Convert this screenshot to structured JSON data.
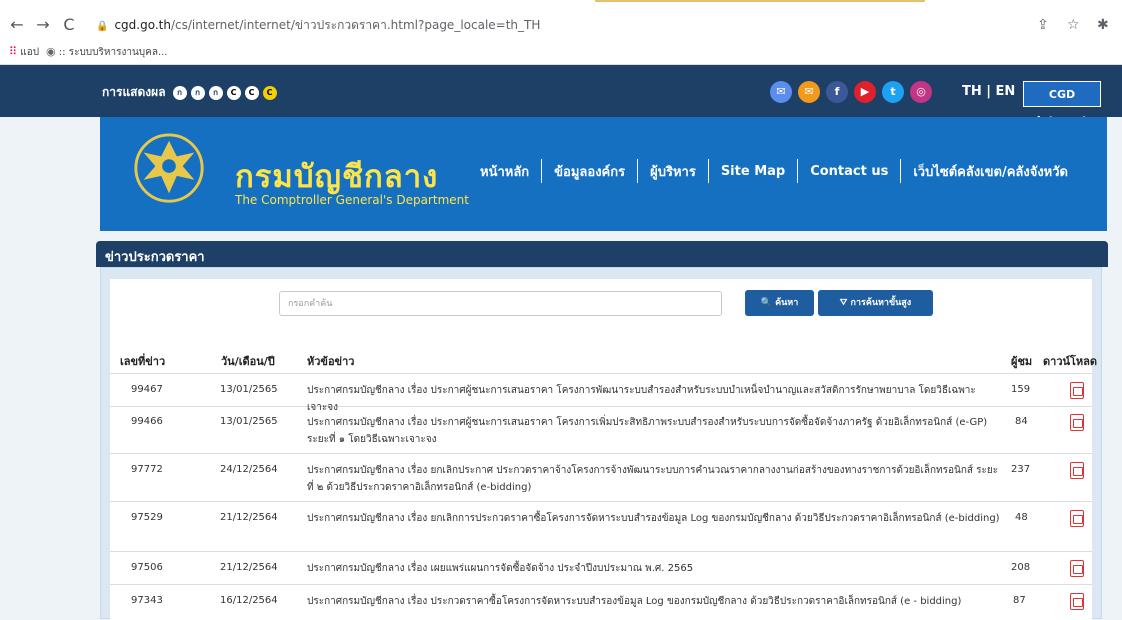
{
  "browser": {
    "url_host": "cgd.go.th",
    "url_path": "/cs/internet/internet/ข่าวประกวดราคา.html?page_locale=th_TH",
    "back_icon": "←",
    "forward_icon": "→",
    "reload_icon": "C",
    "share_icon": "⇪",
    "star_icon": "☆",
    "ext_icon": "✱",
    "bookmarks": [
      {
        "label": "แอป"
      },
      {
        "label": ":: ระบบบริหารงานบุคล..."
      }
    ]
  },
  "topbar": {
    "display_label": "การแสดงผล",
    "display_options": [
      {
        "glyph": "ก",
        "bg": "#ffffff",
        "fg": "#1e3f66"
      },
      {
        "glyph": "ก",
        "bg": "#ffffff",
        "fg": "#1e3f66"
      },
      {
        "glyph": "ก",
        "bg": "#ffffff",
        "fg": "#1e3f66"
      },
      {
        "glyph": "C",
        "bg": "#ffffff",
        "fg": "#000000"
      },
      {
        "glyph": "C",
        "bg": "#ffffff",
        "fg": "#000000"
      },
      {
        "glyph": "C",
        "bg": "#f0d000",
        "fg": "#000000"
      }
    ],
    "social": [
      {
        "name": "email-icon",
        "glyph": "✉",
        "color": "#5b8def"
      },
      {
        "name": "mail-icon",
        "glyph": "✉",
        "color": "#f39a1c"
      },
      {
        "name": "facebook-icon",
        "glyph": "f",
        "color": "#3b5998"
      },
      {
        "name": "youtube-icon",
        "glyph": "▶",
        "color": "#e0212b"
      },
      {
        "name": "twitter-icon",
        "glyph": "t",
        "color": "#1da1f2"
      },
      {
        "name": "instagram-icon",
        "glyph": "◎",
        "color": "#c13584"
      }
    ],
    "lang": "TH | EN",
    "intranet_label": "CGD Intranet"
  },
  "header": {
    "org_th": "กรมบัญชีกลาง",
    "org_en": "The Comptroller General's Department",
    "menu": [
      "หน้าหลัก",
      "ข้อมูลองค์กร",
      "ผู้บริหาร",
      "Site Map",
      "Contact us",
      "เว็บไซต์คลังเขต/คลังจังหวัด"
    ]
  },
  "section": {
    "title": "ข่าวประกวดราคา"
  },
  "search": {
    "placeholder": "กรอกคำค้น",
    "search_label": "🔍 ค้นหา",
    "advanced_label": "⛛ การค้นหาขั้นสูง"
  },
  "table": {
    "headers": {
      "id": "เลขที่ข่าว",
      "date": "วัน/เดือน/ปี",
      "title": "หัวข้อข่าว",
      "views": "ผู้ชม",
      "download": "ดาวน์โหลด"
    },
    "rows": [
      {
        "id": "99467",
        "date": "13/01/2565",
        "title": "ประกาศกรมบัญชีกลาง เรื่อง ประกาศผู้ชนะการเสนอราคา โครงการพัฒนาระบบสำรองสำหรับระบบบำเหน็จบำนาญและสวัสดิการรักษาพยาบาล โดยวิธีเฉพาะเจาะจง",
        "views": "159"
      },
      {
        "id": "99466",
        "date": "13/01/2565",
        "title": "ประกาศกรมบัญชีกลาง เรื่อง ประกาศผู้ชนะการเสนอราคา โครงการเพิ่มประสิทธิภาพระบบสำรองสำหรับระบบการจัดซื้อจัดจ้างภาครัฐ ด้วยอิเล็กทรอนิกส์ (e-GP) ระยะที่ ๑ โดยวิธีเฉพาะเจาะจง",
        "views": "84"
      },
      {
        "id": "97772",
        "date": "24/12/2564",
        "title": "ประกาศกรมบัญชีกลาง เรื่อง ยกเลิกประกาศ ประกวดราคาจ้างโครงการจ้างพัฒนาระบบการคำนวณราคากลางงานก่อสร้างของทางราชการด้วยอิเล็กทรอนิกส์ ระยะที่ ๒ ด้วยวิธีประกวดราคาอิเล็กทรอนิกส์ (e-bidding)",
        "views": "237"
      },
      {
        "id": "97529",
        "date": "21/12/2564",
        "title": "ประกาศกรมบัญชีกลาง เรื่อง ยกเลิกการประกวดราคาซื้อโครงการจัดหาระบบสำรองข้อมูล Log ของกรมบัญชีกลาง ด้วยวิธีประกวดราคาอิเล็กทรอนิกส์ (e-bidding)",
        "views": "48"
      },
      {
        "id": "97506",
        "date": "21/12/2564",
        "title": "ประกาศกรมบัญชีกลาง เรื่อง เผยแพร่แผนการจัดซื้อจัดจ้าง ประจำปีงบประมาณ พ.ศ. 2565",
        "views": "208"
      },
      {
        "id": "97343",
        "date": "16/12/2564",
        "title": "ประกาศกรมบัญชีกลาง เรื่อง ประกวดราคาซื้อโครงการจัดหาระบบสำรองข้อมูล Log ของกรมบัญชีกลาง ด้วยวิธีประกวดราคาอิเล็กทรอนิกส์ (e - bidding)",
        "views": "87"
      }
    ]
  }
}
